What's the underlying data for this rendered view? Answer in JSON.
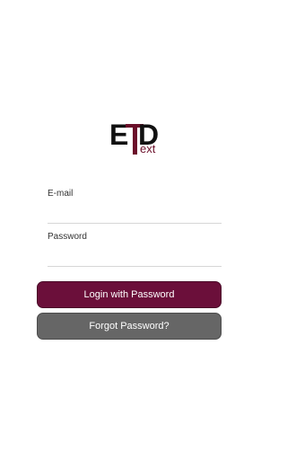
{
  "logo": {
    "letter_e": "E",
    "letter_d": "D",
    "suffix": "ext",
    "color_dark": "#111111",
    "color_brand": "#6b0f2a"
  },
  "form": {
    "email": {
      "label": "E-mail",
      "value": "",
      "placeholder": ""
    },
    "password": {
      "label": "Password",
      "value": "",
      "placeholder": ""
    }
  },
  "buttons": {
    "login_label": "Login with Password",
    "forgot_label": "Forgot Password?"
  },
  "colors": {
    "primary": "#6b0f3a",
    "secondary": "#666666",
    "divider": "#d6d6d6"
  }
}
